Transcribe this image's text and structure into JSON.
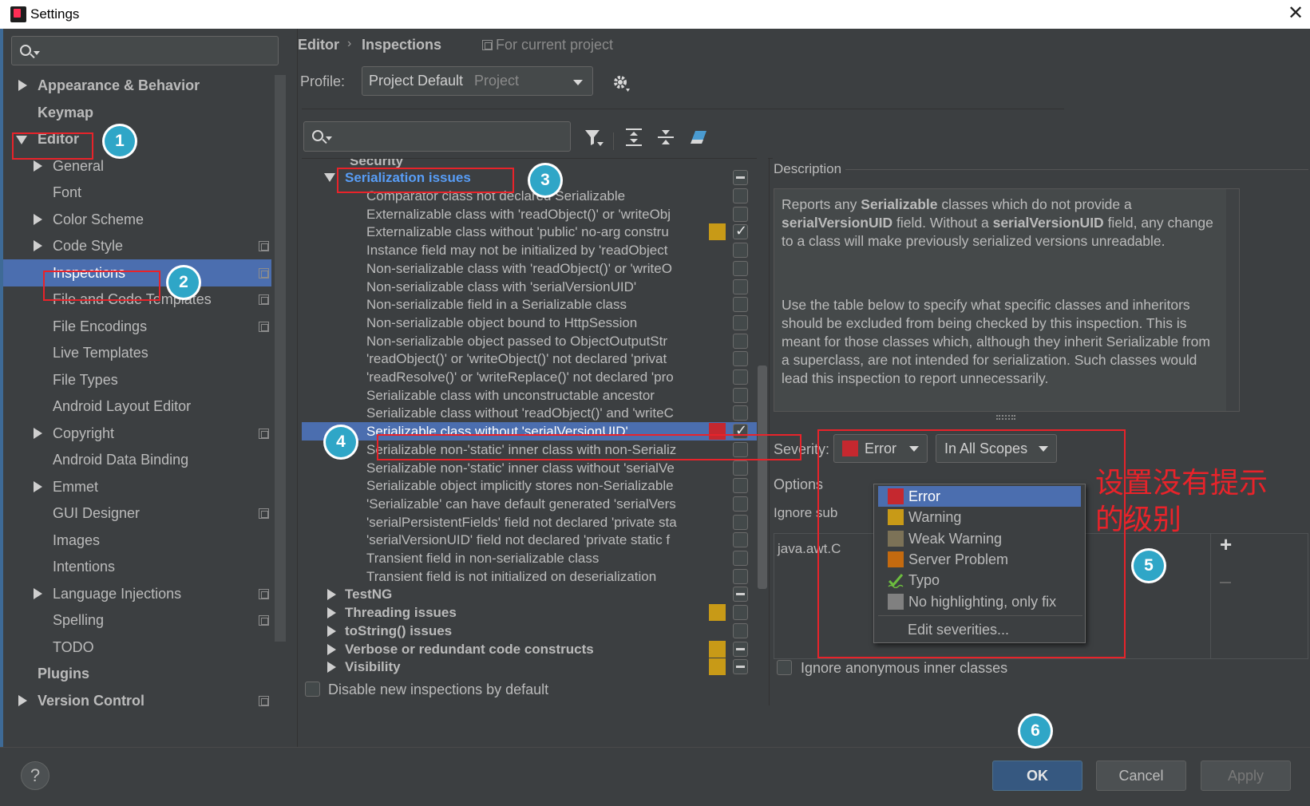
{
  "window": {
    "title": "Settings",
    "close_glyph": "✕"
  },
  "sidebar": {
    "items": [
      {
        "label": "Appearance & Behavior",
        "bold": true,
        "arrow": "right",
        "level": 0
      },
      {
        "label": "Keymap",
        "bold": true,
        "arrow": "none",
        "level": 0
      },
      {
        "label": "Editor",
        "bold": true,
        "arrow": "down",
        "level": 0
      },
      {
        "label": "General",
        "arrow": "right",
        "level": 1
      },
      {
        "label": "Font",
        "arrow": "none",
        "level": 1
      },
      {
        "label": "Color Scheme",
        "arrow": "right",
        "level": 1
      },
      {
        "label": "Code Style",
        "arrow": "right",
        "level": 1,
        "project": true
      },
      {
        "label": "Inspections",
        "arrow": "none",
        "level": 1,
        "project": true,
        "selected": true
      },
      {
        "label": "File and Code Templates",
        "arrow": "none",
        "level": 1,
        "project": true
      },
      {
        "label": "File Encodings",
        "arrow": "none",
        "level": 1,
        "project": true
      },
      {
        "label": "Live Templates",
        "arrow": "none",
        "level": 1
      },
      {
        "label": "File Types",
        "arrow": "none",
        "level": 1
      },
      {
        "label": "Android Layout Editor",
        "arrow": "none",
        "level": 1
      },
      {
        "label": "Copyright",
        "arrow": "right",
        "level": 1,
        "project": true
      },
      {
        "label": "Android Data Binding",
        "arrow": "none",
        "level": 1
      },
      {
        "label": "Emmet",
        "arrow": "right",
        "level": 1
      },
      {
        "label": "GUI Designer",
        "arrow": "none",
        "level": 1,
        "project": true
      },
      {
        "label": "Images",
        "arrow": "none",
        "level": 1
      },
      {
        "label": "Intentions",
        "arrow": "none",
        "level": 1
      },
      {
        "label": "Language Injections",
        "arrow": "right",
        "level": 1,
        "project": true
      },
      {
        "label": "Spelling",
        "arrow": "none",
        "level": 1,
        "project": true
      },
      {
        "label": "TODO",
        "arrow": "none",
        "level": 1
      },
      {
        "label": "Plugins",
        "bold": true,
        "arrow": "none",
        "level": 0
      },
      {
        "label": "Version Control",
        "bold": true,
        "arrow": "right",
        "level": 0,
        "project": true
      }
    ]
  },
  "header": {
    "crumb1": "Editor",
    "sep": "›",
    "crumb2": "Inspections",
    "scope": "For current project"
  },
  "profile": {
    "label": "Profile:",
    "value": "Project Default",
    "hint": "Project"
  },
  "inspections": {
    "partial_top": "Security",
    "group": "Serialization issues",
    "items": [
      {
        "label": "Comparator class not declared Serializable",
        "check": "off"
      },
      {
        "label": "Externalizable class with 'readObject()' or 'writeObj",
        "check": "off"
      },
      {
        "label": "Externalizable class without 'public' no-arg constru",
        "check": "on",
        "sev": "#c89a17"
      },
      {
        "label": "Instance field may not be initialized by 'readObject",
        "check": "off"
      },
      {
        "label": "Non-serializable class with 'readObject()' or 'writeO",
        "check": "off"
      },
      {
        "label": "Non-serializable class with 'serialVersionUID'",
        "check": "off"
      },
      {
        "label": "Non-serializable field in a Serializable class",
        "check": "off"
      },
      {
        "label": "Non-serializable object bound to HttpSession",
        "check": "off"
      },
      {
        "label": "Non-serializable object passed to ObjectOutputStr",
        "check": "off"
      },
      {
        "label": "'readObject()' or 'writeObject()' not declared 'privat",
        "check": "off"
      },
      {
        "label": "'readResolve()' or 'writeReplace()' not declared 'pro",
        "check": "off"
      },
      {
        "label": "Serializable class with unconstructable ancestor",
        "check": "off"
      },
      {
        "label": "Serializable class without 'readObject()' and 'writeC",
        "check": "off"
      },
      {
        "label": "Serializable class without 'serialVersionUID'",
        "check": "on",
        "sev": "#c5282f",
        "selected": true
      },
      {
        "label": "Serializable non-'static' inner class with non-Serializ",
        "check": "off"
      },
      {
        "label": "Serializable non-'static' inner class without 'serialVe",
        "check": "off"
      },
      {
        "label": "Serializable object implicitly stores non-Serializable",
        "check": "off"
      },
      {
        "label": "'Serializable' can have default generated 'serialVers",
        "check": "off"
      },
      {
        "label": "'serialPersistentFields' field not declared 'private sta",
        "check": "off"
      },
      {
        "label": "'serialVersionUID' field not declared 'private static f",
        "check": "off"
      },
      {
        "label": "Transient field in non-serializable class",
        "check": "off"
      },
      {
        "label": "Transient field is not initialized on deserialization",
        "check": "off"
      }
    ],
    "groups_after": [
      {
        "label": "TestNG",
        "check": "dash"
      },
      {
        "label": "Threading issues",
        "check": "off",
        "sev": "#c89a17"
      },
      {
        "label": "toString() issues",
        "check": "off"
      },
      {
        "label": "Verbose or redundant code constructs",
        "check": "dash",
        "sev": "#c89a17"
      },
      {
        "label": "Visibility",
        "check": "dash",
        "sev": "#c89a17"
      }
    ],
    "disable_new_label": "Disable new inspections by default"
  },
  "description": {
    "heading": "Description",
    "p1": [
      {
        "t": "Reports any ",
        "b": false
      },
      {
        "t": "Serializable",
        "b": true
      },
      {
        "t": " classes which do not provide a ",
        "b": false
      },
      {
        "t": "serialVersionUID",
        "b": true
      },
      {
        "t": " field. Without a ",
        "b": false
      },
      {
        "t": "serialVersionUID",
        "b": true
      },
      {
        "t": " field, any change to a class will make previously serialized versions unreadable.",
        "b": false
      }
    ],
    "p2": "Use the table below to specify what specific classes and inheritors should be excluded from being checked by this inspection. This is meant for those classes which, although they inherit Serializable from a superclass, are not intended for serialization. Such classes would lead this inspection to report unnecessarily."
  },
  "severity": {
    "label": "Severity:",
    "value": "Error",
    "value_color": "#c5282f",
    "scope": "In All Scopes",
    "options_label": "Options",
    "ignore_sub_label": "Ignore sub",
    "table_row": "java.awt.C",
    "ignore_anon_label": "Ignore anonymous inner classes",
    "menu": [
      {
        "label": "Error",
        "color": "#c5282f",
        "selected": true
      },
      {
        "label": "Warning",
        "color": "#c89a17"
      },
      {
        "label": "Weak Warning",
        "color": "#7c7257"
      },
      {
        "label": "Server Problem",
        "color": "#c46a0f"
      },
      {
        "label": "Typo",
        "color": "typo"
      },
      {
        "label": "No highlighting, only fix",
        "color": "#808080"
      }
    ],
    "menu_footer": "Edit severities..."
  },
  "buttons": {
    "help": "?",
    "ok": "OK",
    "cancel": "Cancel",
    "apply": "Apply"
  },
  "annotations": {
    "badges": [
      "1",
      "2",
      "3",
      "4",
      "5",
      "6"
    ],
    "note_line1": "设置没有提示",
    "note_line2": "的级别",
    "color": "#e8232a"
  }
}
